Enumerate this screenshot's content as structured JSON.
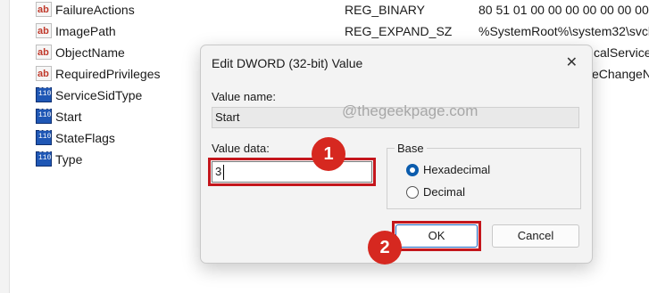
{
  "registry": {
    "rows": [
      {
        "icon": "string-value-icon",
        "icon_text": "ab",
        "name": "FailureActions",
        "type": "REG_BINARY",
        "data": "80 51 01 00 00 00 00 00 00 00"
      },
      {
        "icon": "string-value-icon",
        "icon_text": "ab",
        "name": "ImagePath",
        "type": "REG_EXPAND_SZ",
        "data": "%SystemRoot%\\system32\\svchost"
      },
      {
        "icon": "string-value-icon",
        "icon_text": "ab",
        "name": "ObjectName",
        "type": "",
        "data": "calService"
      },
      {
        "icon": "string-value-icon",
        "icon_text": "ab",
        "name": "RequiredPrivileges",
        "type": "",
        "data": "eChangeN"
      },
      {
        "icon": "binary-value-icon",
        "icon_text": "010\n110",
        "name": "ServiceSidType",
        "type": "",
        "data": ""
      },
      {
        "icon": "binary-value-icon",
        "icon_text": "010\n110",
        "name": "Start",
        "type": "",
        "data": ""
      },
      {
        "icon": "binary-value-icon",
        "icon_text": "010\n110",
        "name": "StateFlags",
        "type": "",
        "data": ""
      },
      {
        "icon": "binary-value-icon",
        "icon_text": "010\n110",
        "name": "Type",
        "type": "",
        "data": ""
      }
    ]
  },
  "dialog": {
    "title": "Edit DWORD (32-bit) Value",
    "close_glyph": "✕",
    "value_name_label": "Value name:",
    "value_name": "Start",
    "watermark": "@thegeekpage.com",
    "value_data_label": "Value data:",
    "value_data": "3",
    "base_label": "Base",
    "base_options": [
      {
        "label": "Hexadecimal",
        "selected": true
      },
      {
        "label": "Decimal",
        "selected": false
      }
    ],
    "ok_label": "OK",
    "cancel_label": "Cancel"
  },
  "annotations": {
    "step1": "1",
    "step2": "2",
    "highlight_color": "#c4161c",
    "badge_color": "#d62820"
  }
}
